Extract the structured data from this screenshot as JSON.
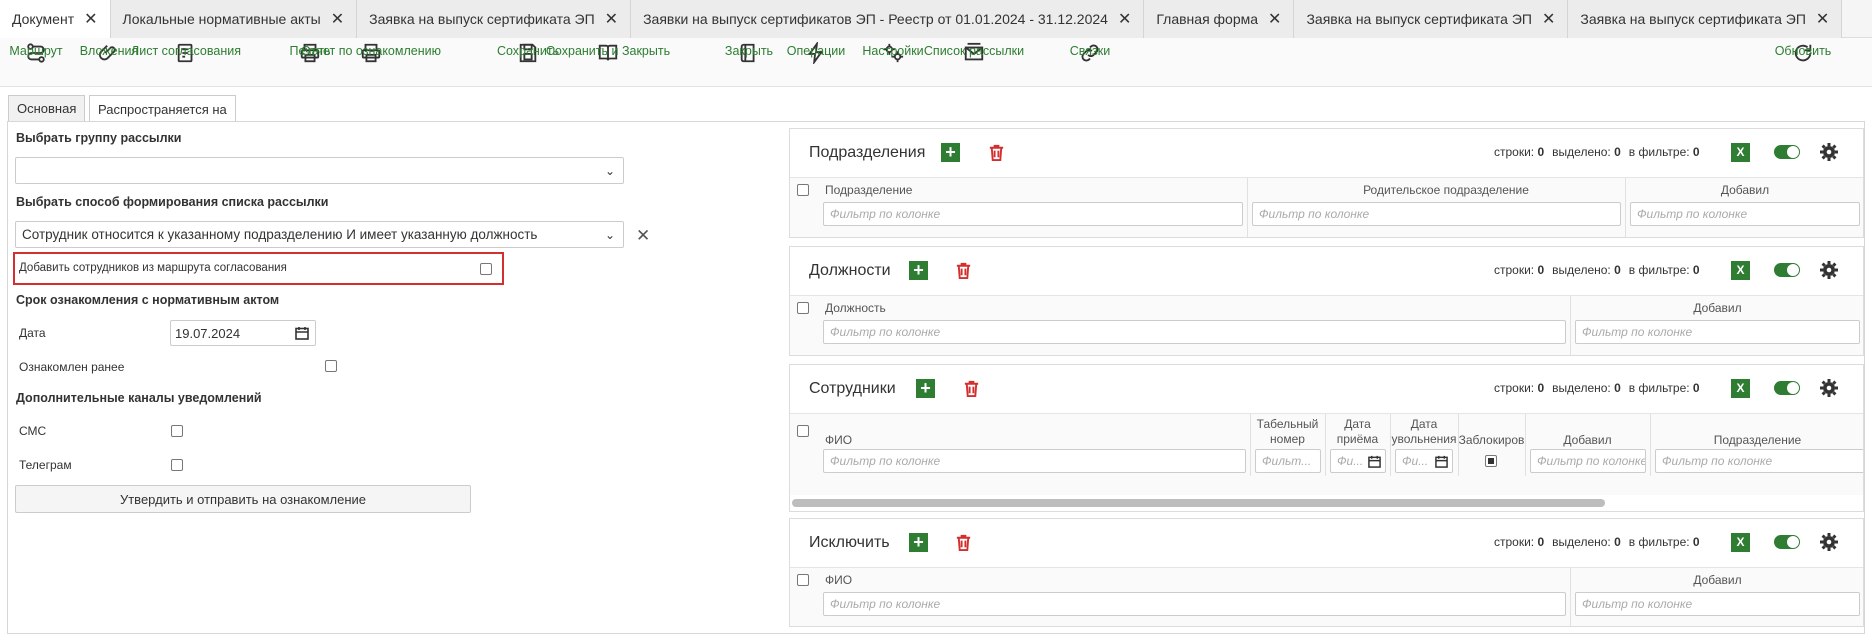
{
  "tabs": [
    {
      "label": "Документ"
    },
    {
      "label": "Локальные нормативные акты"
    },
    {
      "label": "Заявка на выпуск сертификата ЭП"
    },
    {
      "label": "Заявки на выпуск сертификатов ЭП - Реестр от 01.01.2024 - 31.12.2024"
    },
    {
      "label": "Главная форма"
    },
    {
      "label": "Заявка на выпуск сертификата ЭП"
    },
    {
      "label": "Заявка на выпуск сертификата ЭП"
    }
  ],
  "toolbar": {
    "route": "Маршрут",
    "attachments": "Вложения",
    "approval_sheet": "Лист согласования",
    "print": "Печать",
    "report": "Отчет по ознакомлению",
    "save": "Сохранить",
    "save_close": "Сохранить и Закрыть",
    "close": "Закрыть",
    "operations": "Операции",
    "settings": "Настройки",
    "mailing_list": "Список рассылки",
    "links": "Связки",
    "refresh": "Обновить"
  },
  "inner_tabs": {
    "main": "Основная",
    "applies_to": "Распространяется на"
  },
  "form": {
    "group_label": "Выбрать группу рассылки",
    "group_value": "",
    "method_label": "Выбрать способ формирования списка рассылки",
    "method_value": "Сотрудник относится к указанному подразделению И имеет указанную должность",
    "add_from_route": "Добавить сотрудников из маршрута согласования",
    "deadline_label": "Срок ознакомления с нормативным актом",
    "date_label": "Дата",
    "date_value": "19.07.2024",
    "acquainted_label": "Ознакомлен ранее",
    "channels_label": "Дополнительные каналы уведомлений",
    "sms_label": "СМС",
    "telegram_label": "Телеграм",
    "approve_button": "Утвердить и отправить на ознакомление"
  },
  "stats_labels": {
    "rows": "строки:",
    "selected": "выделено:",
    "in_filter": "в фильтре:"
  },
  "filter_placeholder": "Фильтр по колонке",
  "filter_short": "Фильт...",
  "filter_tiny": "Фи...",
  "panels": {
    "departments": {
      "title": "Подразделения",
      "rows": "0",
      "selected": "0",
      "in_filter": "0",
      "cols": [
        "Подразделение",
        "Родительское подразделение",
        "Добавил"
      ]
    },
    "positions": {
      "title": "Должности",
      "rows": "0",
      "selected": "0",
      "in_filter": "0",
      "cols": [
        "Должность",
        "Добавил"
      ]
    },
    "employees": {
      "title": "Сотрудники",
      "rows": "0",
      "selected": "0",
      "in_filter": "0",
      "cols": [
        "ФИО",
        "Табельный номер",
        "Дата приёма",
        "Дата увольнения",
        "Заблокиров",
        "Добавил",
        "Подразделение"
      ]
    },
    "exclude": {
      "title": "Исключить",
      "rows": "0",
      "selected": "0",
      "in_filter": "0",
      "cols": [
        "ФИО",
        "Добавил"
      ]
    }
  },
  "colors": {
    "accent": "#2e7d32",
    "danger": "#d32f2f"
  }
}
